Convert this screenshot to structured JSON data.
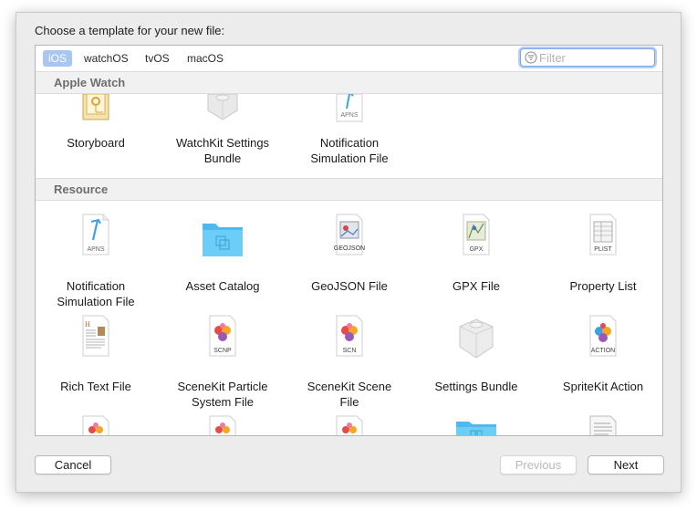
{
  "dialog": {
    "title": "Choose a template for your new file:"
  },
  "tabs": [
    {
      "label": "iOS",
      "active": true
    },
    {
      "label": "watchOS",
      "active": false
    },
    {
      "label": "tvOS",
      "active": false
    },
    {
      "label": "macOS",
      "active": false
    }
  ],
  "filter": {
    "placeholder": "Filter",
    "value": ""
  },
  "sections": {
    "apple_watch": {
      "title": "Apple Watch",
      "items": [
        {
          "label": "Storyboard",
          "icon": "storyboard-icon"
        },
        {
          "label": "WatchKit Settings\nBundle",
          "icon": "settings-bundle-icon"
        },
        {
          "label": "Notification\nSimulation File",
          "icon": "apns-file-icon",
          "badge": "APNS"
        }
      ]
    },
    "resource": {
      "title": "Resource",
      "items": [
        {
          "label": "Notification\nSimulation File",
          "icon": "apns-file-icon",
          "badge": "APNS"
        },
        {
          "label": "Asset Catalog",
          "icon": "folder-icon"
        },
        {
          "label": "GeoJSON File",
          "icon": "geojson-file-icon",
          "badge": "GEOJSON"
        },
        {
          "label": "GPX File",
          "icon": "gpx-file-icon",
          "badge": "GPX"
        },
        {
          "label": "Property List",
          "icon": "plist-file-icon",
          "badge": "PLIST"
        },
        {
          "label": "Rich Text File",
          "icon": "rich-text-file-icon"
        },
        {
          "label": "SceneKit Particle\nSystem File",
          "icon": "scenekit-particle-icon",
          "badge": "SCNP"
        },
        {
          "label": "SceneKit Scene\nFile",
          "icon": "scenekit-scene-icon",
          "badge": "SCN"
        },
        {
          "label": "Settings Bundle",
          "icon": "settings-bundle-icon"
        },
        {
          "label": "SpriteKit Action",
          "icon": "spritekit-action-icon",
          "badge": "ACTION"
        }
      ]
    }
  },
  "buttons": {
    "cancel": "Cancel",
    "previous": "Previous",
    "next": "Next"
  },
  "colors": {
    "accent": "#a8c7f0",
    "folder": "#5ac4f4",
    "sheet_bg": "#ececec"
  }
}
